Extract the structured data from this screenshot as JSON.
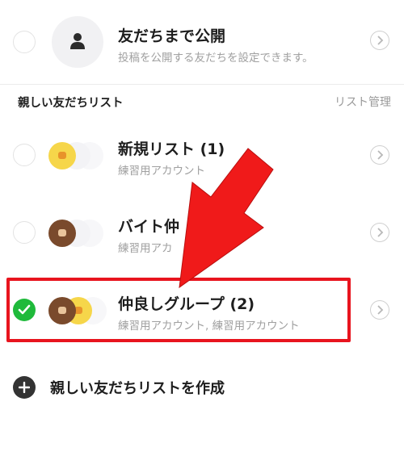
{
  "public": {
    "title": "友だちまで公開",
    "subtitle": "投稿を公開する友だちを設定できます。"
  },
  "section": {
    "label": "親しい友だちリスト",
    "action": "リスト管理"
  },
  "lists": [
    {
      "title": "新規リスト (1)",
      "subtitle": "練習用アカウント",
      "selected": false
    },
    {
      "title": "バイト仲",
      "subtitle": "練習用アカ",
      "selected": false
    },
    {
      "title": "仲良しグループ (2)",
      "subtitle": "練習用アカウント, 練習用アカウント",
      "selected": true
    }
  ],
  "create": {
    "label": "親しい友だちリストを作成"
  },
  "colors": {
    "accent": "#1fba3b",
    "highlight": "#e8141e",
    "arrow": "#f01a1a"
  }
}
